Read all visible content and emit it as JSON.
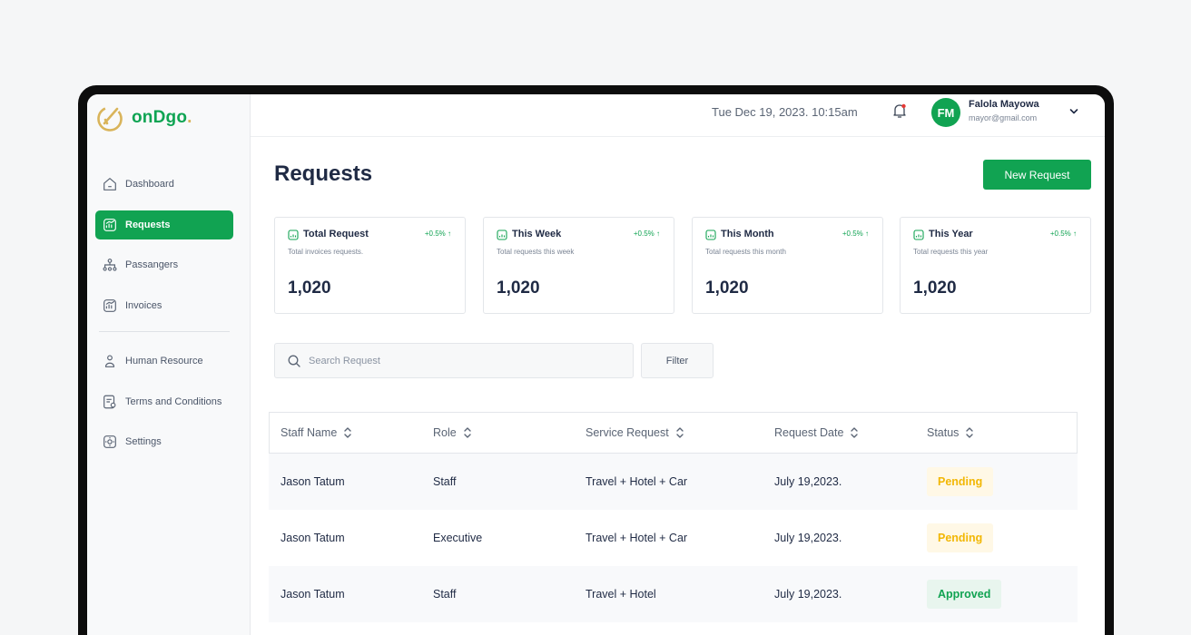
{
  "app": {
    "logo_text": "onDgo",
    "logo_dot": "."
  },
  "sidebar": {
    "items": [
      {
        "label": "Dashboard",
        "icon": "home-icon",
        "active": false
      },
      {
        "label": "Requests",
        "icon": "chart-icon",
        "active": true
      },
      {
        "label": "Passangers",
        "icon": "users-icon",
        "active": false
      },
      {
        "label": "Invoices",
        "icon": "invoice-icon",
        "active": false
      }
    ],
    "items_secondary": [
      {
        "label": "Human Resource",
        "icon": "person-icon"
      },
      {
        "label": "Terms and Conditions",
        "icon": "document-icon"
      },
      {
        "label": "Settings",
        "icon": "gear-icon"
      }
    ]
  },
  "header": {
    "datetime": "Tue Dec 19, 2023. 10:15am",
    "user_initials": "FM",
    "user_name": "Falola Mayowa",
    "user_email": "mayor@gmail.com"
  },
  "main": {
    "title": "Requests",
    "new_button": "New Request",
    "cards": [
      {
        "title": "Total Request",
        "change": "+0.5%",
        "subtitle": "Total invoices requests.",
        "value": "1,020"
      },
      {
        "title": "This Week",
        "change": "+0.5%",
        "subtitle": "Total requests this week",
        "value": "1,020"
      },
      {
        "title": "This Month",
        "change": "+0.5%",
        "subtitle": "Total requests this month",
        "value": "1,020"
      },
      {
        "title": "This Year",
        "change": "+0.5%",
        "subtitle": "Total requests this year",
        "value": "1,020"
      }
    ],
    "search_placeholder": "Search Request",
    "filter_label": "Filter",
    "table": {
      "columns": [
        "Staff Name",
        "Role",
        "Service Request",
        "Request Date",
        "Status"
      ],
      "rows": [
        {
          "name": "Jason Tatum",
          "role": "Staff",
          "service": "Travel + Hotel + Car",
          "date": "July 19,2023.",
          "status": "Pending"
        },
        {
          "name": "Jason Tatum",
          "role": "Executive",
          "service": "Travel + Hotel + Car",
          "date": "July 19,2023.",
          "status": "Pending"
        },
        {
          "name": "Jason Tatum",
          "role": "Staff",
          "service": "Travel + Hotel",
          "date": "July 19,2023.",
          "status": "Approved"
        }
      ]
    }
  },
  "colors": {
    "brand_green": "#11a352",
    "pending": "#f2b705",
    "accent_gold": "#d9b45a"
  }
}
